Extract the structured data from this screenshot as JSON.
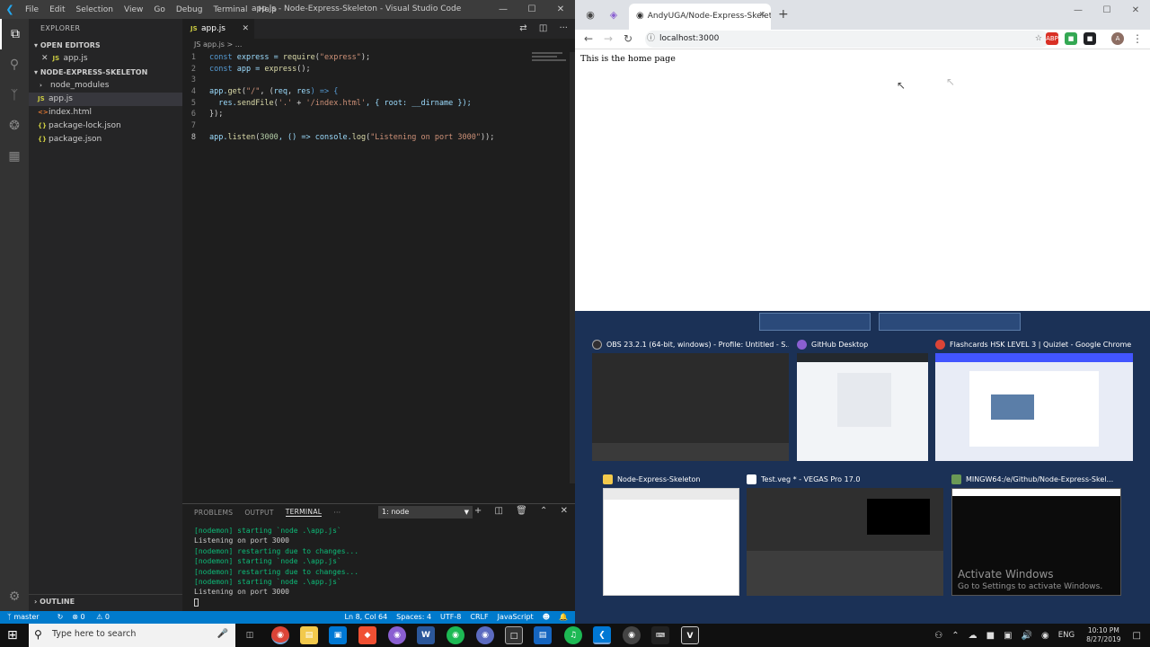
{
  "vscode": {
    "menu": [
      "File",
      "Edit",
      "Selection",
      "View",
      "Go",
      "Debug",
      "Terminal",
      "Help"
    ],
    "window_title": "app.js - Node-Express-Skeleton - Visual Studio Code",
    "explorer_title": "EXPLORER",
    "open_editors_label": "OPEN EDITORS",
    "open_editor_file": "app.js",
    "project_label": "NODE-EXPRESS-SKELETON",
    "files": [
      {
        "name": "node_modules",
        "icon": "folder-chevron"
      },
      {
        "name": "app.js",
        "icon": "JS"
      },
      {
        "name": "index.html",
        "icon": "<>"
      },
      {
        "name": "package-lock.json",
        "icon": "{}"
      },
      {
        "name": "package.json",
        "icon": "{}"
      }
    ],
    "outline_label": "OUTLINE",
    "tab_label": "app.js",
    "breadcrumb": "JS app.js > ...",
    "code_line_numbers": [
      "1",
      "2",
      "3",
      "4",
      "5",
      "6",
      "7",
      "8"
    ],
    "code": {
      "l1": [
        "const",
        " express = ",
        "require",
        "(",
        "\"express\"",
        ");"
      ],
      "l2": [
        "const",
        " app = ",
        "express",
        "();"
      ],
      "l4": [
        "app.",
        "get",
        "(",
        "\"/\"",
        ", (",
        "req",
        ", ",
        "res",
        ") => {"
      ],
      "l5": [
        "  res.",
        "sendFile",
        "(",
        "'.'",
        " + ",
        "'/index.html'",
        ", { root: __dirname });"
      ],
      "l6": [
        "});"
      ],
      "l8": [
        "app.",
        "listen",
        "(",
        "3000",
        ", () => console.",
        "log",
        "(",
        "\"Listening on port 3000\"",
        "));"
      ]
    },
    "panel_tabs": [
      "PROBLEMS",
      "OUTPUT",
      "TERMINAL",
      "···"
    ],
    "terminal_select": "1: node",
    "terminal_lines": [
      {
        "text": "[nodemon] starting `node .\\app.js`",
        "color": "green"
      },
      {
        "text": "Listening on port 3000",
        "color": "white"
      },
      {
        "text": "[nodemon] restarting due to changes...",
        "color": "green"
      },
      {
        "text": "[nodemon] starting `node .\\app.js`",
        "color": "green"
      },
      {
        "text": "[nodemon] restarting due to changes...",
        "color": "green"
      },
      {
        "text": "[nodemon] starting `node .\\app.js`",
        "color": "green"
      },
      {
        "text": "Listening on port 3000",
        "color": "white"
      }
    ],
    "status": {
      "branch": "master",
      "errors": "0",
      "warnings": "0",
      "cursor": "Ln 8, Col 64",
      "spaces": "Spaces: 4",
      "encoding": "UTF-8",
      "eol": "CRLF",
      "language": "JavaScript"
    },
    "accent": "#007acc"
  },
  "chrome": {
    "tab_title": "AndyUGA/Node-Express-Skeleton",
    "url": "localhost:3000",
    "page_text": "This is the home page"
  },
  "taskview": {
    "windows": [
      {
        "title": "OBS 23.2.1 (64-bit, windows) - Profile: Untitled - S...",
        "icon_color": "#302e31"
      },
      {
        "title": "GitHub Desktop",
        "icon_color": "#8a5fd1"
      },
      {
        "title": "Flashcards HSK LEVEL 3 | Quizlet - Google Chrome",
        "icon_color": "#db4437"
      },
      {
        "title": "Node-Express-Skeleton",
        "icon_color": "#f2c94c"
      },
      {
        "title": "Test.veg * - VEGAS Pro 17.0",
        "icon_color": "#ffffff"
      },
      {
        "title": "MINGW64:/e/Github/Node-Express-Skel...",
        "icon_color": "#6a9955"
      }
    ],
    "activate_title": "Activate Windows",
    "activate_sub": "Go to Settings to activate Windows."
  },
  "taskbar": {
    "search_placeholder": "Type here to search",
    "language": "ENG",
    "time": "10:10 PM",
    "date": "8/27/2019"
  }
}
